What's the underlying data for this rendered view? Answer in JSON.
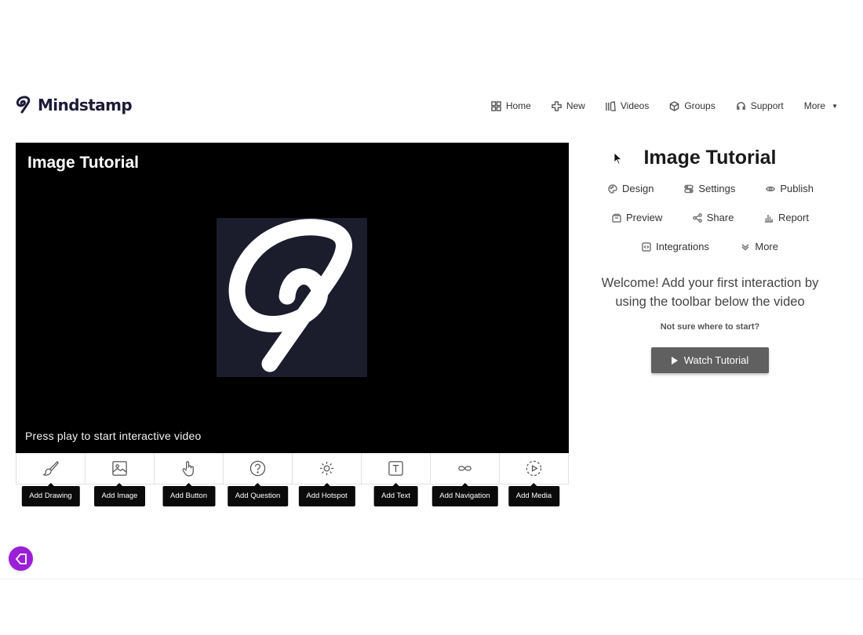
{
  "brand": {
    "name": "Mindstamp"
  },
  "nav": {
    "items": [
      {
        "label": "Home",
        "icon": "grid-icon"
      },
      {
        "label": "New",
        "icon": "plus-icon"
      },
      {
        "label": "Videos",
        "icon": "library-icon"
      },
      {
        "label": "Groups",
        "icon": "groups-icon"
      },
      {
        "label": "Support",
        "icon": "headset-icon"
      }
    ],
    "more_label": "More"
  },
  "player": {
    "title": "Image Tutorial",
    "overlay_text": "Press play to start interactive video"
  },
  "toolbar": {
    "items": [
      {
        "label": "Add Drawing",
        "icon": "brush-icon"
      },
      {
        "label": "Add Image",
        "icon": "image-icon"
      },
      {
        "label": "Add Button",
        "icon": "pointer-hand-icon"
      },
      {
        "label": "Add Question",
        "icon": "question-icon"
      },
      {
        "label": "Add Hotspot",
        "icon": "sun-icon"
      },
      {
        "label": "Add Text",
        "icon": "text-icon"
      },
      {
        "label": "Add Navigation",
        "icon": "infinity-icon"
      },
      {
        "label": "Add Media",
        "icon": "play-circle-icon"
      }
    ]
  },
  "panel": {
    "title": "Image Tutorial",
    "menu": {
      "design": "Design",
      "settings": "Settings",
      "publish": "Publish",
      "preview": "Preview",
      "share": "Share",
      "report": "Report",
      "integrations": "Integrations",
      "more": "More"
    },
    "welcome_line1": "Welcome! Add your first interaction by",
    "welcome_line2": "using the toolbar below the video",
    "not_sure": "Not sure where to start?",
    "watch_button": "Watch Tutorial"
  },
  "colors": {
    "accent_purple": "#9b1fd6",
    "brand_navy": "#1d1b36",
    "button_gray": "#606060",
    "player_bg": "#000000"
  }
}
